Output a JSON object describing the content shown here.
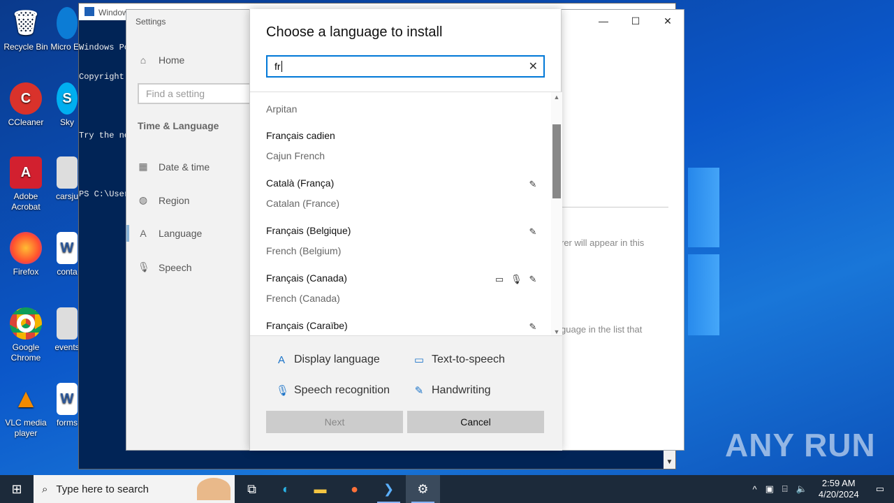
{
  "desktop": {
    "icons": [
      {
        "label": "Recycle Bin",
        "icon": "recycle-bin-icon"
      },
      {
        "label": "CCleaner",
        "icon": "ccleaner-icon"
      },
      {
        "label": "Adobe Acrobat",
        "icon": "acrobat-icon"
      },
      {
        "label": "Firefox",
        "icon": "firefox-icon"
      },
      {
        "label": "Google Chrome",
        "icon": "chrome-icon"
      },
      {
        "label": "VLC media player",
        "icon": "vlc-icon"
      },
      {
        "label": "Micro Ed",
        "icon": "edge-icon"
      },
      {
        "label": "Sky",
        "icon": "skype-icon"
      },
      {
        "label": "carsju",
        "icon": "image-file-icon"
      },
      {
        "label": "conta",
        "icon": "word-file-icon"
      },
      {
        "label": "events",
        "icon": "image-file-icon"
      },
      {
        "label": "forms",
        "icon": "word-file-icon"
      }
    ],
    "watermark": "ANY RUN"
  },
  "powershell": {
    "title": "Windows PowerShell",
    "lines": [
      "Windows Po",
      "Copyright",
      "",
      "Try the ne",
      "",
      "PS C:\\User"
    ]
  },
  "settings": {
    "title": "Settings",
    "nav": {
      "home": "Home",
      "find_placeholder": "Find a setting",
      "section": "Time & Language",
      "items": [
        {
          "label": "Date & time",
          "icon": "calendar-clock-icon"
        },
        {
          "label": "Region",
          "icon": "globe-icon"
        },
        {
          "label": "Language",
          "icon": "language-icon"
        },
        {
          "label": "Speech",
          "icon": "microphone-icon"
        }
      ]
    },
    "background_text": {
      "line1": "rer will appear in this",
      "line2": "guage in the list that"
    }
  },
  "dialog": {
    "title": "Choose a language to install",
    "search_value": "fr",
    "languages": [
      {
        "native": "",
        "english": "Arpitan",
        "features": []
      },
      {
        "native": "Français cadien",
        "english": "Cajun French",
        "features": []
      },
      {
        "native": "Català (França)",
        "english": "Catalan (France)",
        "features": [
          "handwriting"
        ]
      },
      {
        "native": "Français (Belgique)",
        "english": "French (Belgium)",
        "features": [
          "handwriting"
        ]
      },
      {
        "native": "Français (Canada)",
        "english": "French (Canada)",
        "features": [
          "text-to-speech",
          "speech",
          "handwriting"
        ]
      },
      {
        "native": "Français (Caraïbe)",
        "english": "",
        "features": [
          "handwriting"
        ]
      }
    ],
    "legend": {
      "display": "Display language",
      "tts": "Text-to-speech",
      "speech": "Speech recognition",
      "handwriting": "Handwriting"
    },
    "next_label": "Next",
    "cancel_label": "Cancel"
  },
  "taskbar": {
    "search_placeholder": "Type here to search",
    "time": "2:59 AM",
    "date": "4/20/2024"
  }
}
